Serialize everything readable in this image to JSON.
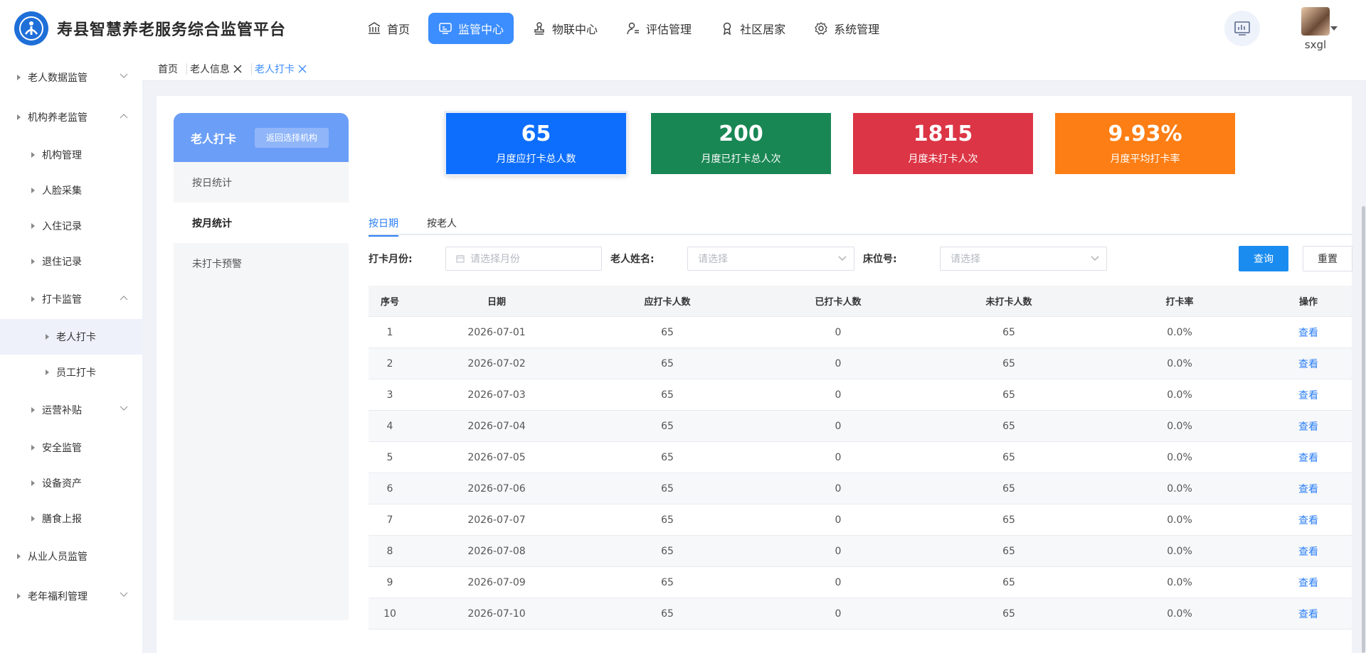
{
  "app": {
    "title": "寿县智慧养老服务综合监管平台"
  },
  "nav": [
    {
      "label": "首页",
      "icon": "bank-icon"
    },
    {
      "label": "监管中心",
      "icon": "monitor-icon",
      "active": true
    },
    {
      "label": "物联中心",
      "icon": "stamp-icon"
    },
    {
      "label": "评估管理",
      "icon": "user-list-icon"
    },
    {
      "label": "社区居家",
      "icon": "badge-icon"
    },
    {
      "label": "系统管理",
      "icon": "gear-icon"
    }
  ],
  "user": {
    "name": "sxgl"
  },
  "sidebar": [
    {
      "label": "老人数据监管",
      "level": 1
    },
    {
      "label": "机构养老监管",
      "level": 1
    },
    {
      "label": "机构管理",
      "level": 2
    },
    {
      "label": "人脸采集",
      "level": 2
    },
    {
      "label": "入住记录",
      "level": 2
    },
    {
      "label": "退住记录",
      "level": 2
    },
    {
      "label": "打卡监管",
      "level": 2
    },
    {
      "label": "老人打卡",
      "level": 3
    },
    {
      "label": "员工打卡",
      "level": 3
    },
    {
      "label": "运营补贴",
      "level": 2
    },
    {
      "label": "安全监管",
      "level": 2
    },
    {
      "label": "设备资产",
      "level": 2
    },
    {
      "label": "膳食上报",
      "level": 2
    },
    {
      "label": "从业人员监管",
      "level": 1
    },
    {
      "label": "老年福利管理",
      "level": 1
    }
  ],
  "breadcrumb": [
    "首页",
    "老人信息",
    "老人打卡"
  ],
  "left_menu": {
    "title": "老人打卡",
    "back_label": "返回选择机构",
    "items": [
      "按日统计",
      "按月统计",
      "未打卡预警"
    ]
  },
  "stats": [
    {
      "value": "65",
      "label": "月度应打卡总人数",
      "color": "#0d6efd"
    },
    {
      "value": "200",
      "label": "月度已打卡总人次",
      "color": "#198754"
    },
    {
      "value": "1815",
      "label": "月度未打卡人次",
      "color": "#dc3545"
    },
    {
      "value": "9.93%",
      "label": "月度平均打卡率",
      "color": "#fd7e14"
    }
  ],
  "tabs": [
    "按日期",
    "按老人"
  ],
  "filters": {
    "month_label": "打卡月份:",
    "month_placeholder": "请选择月份",
    "name_label": "老人姓名:",
    "name_placeholder": "请选择",
    "bed_label": "床位号:",
    "bed_placeholder": "请选择",
    "query_label": "查询",
    "reset_label": "重置"
  },
  "table": {
    "headers": [
      "序号",
      "日期",
      "应打卡人数",
      "已打卡人数",
      "未打卡人数",
      "打卡率",
      "操作"
    ],
    "action_label": "查看",
    "rows": [
      [
        "1",
        "2026-07-01",
        "65",
        "0",
        "65",
        "0.0%"
      ],
      [
        "2",
        "2026-07-02",
        "65",
        "0",
        "65",
        "0.0%"
      ],
      [
        "3",
        "2026-07-03",
        "65",
        "0",
        "65",
        "0.0%"
      ],
      [
        "4",
        "2026-07-04",
        "65",
        "0",
        "65",
        "0.0%"
      ],
      [
        "5",
        "2026-07-05",
        "65",
        "0",
        "65",
        "0.0%"
      ],
      [
        "6",
        "2026-07-06",
        "65",
        "0",
        "65",
        "0.0%"
      ],
      [
        "7",
        "2026-07-07",
        "65",
        "0",
        "65",
        "0.0%"
      ],
      [
        "8",
        "2026-07-08",
        "65",
        "0",
        "65",
        "0.0%"
      ],
      [
        "9",
        "2026-07-09",
        "65",
        "0",
        "65",
        "0.0%"
      ],
      [
        "10",
        "2026-07-10",
        "65",
        "0",
        "65",
        "0.0%"
      ]
    ]
  }
}
